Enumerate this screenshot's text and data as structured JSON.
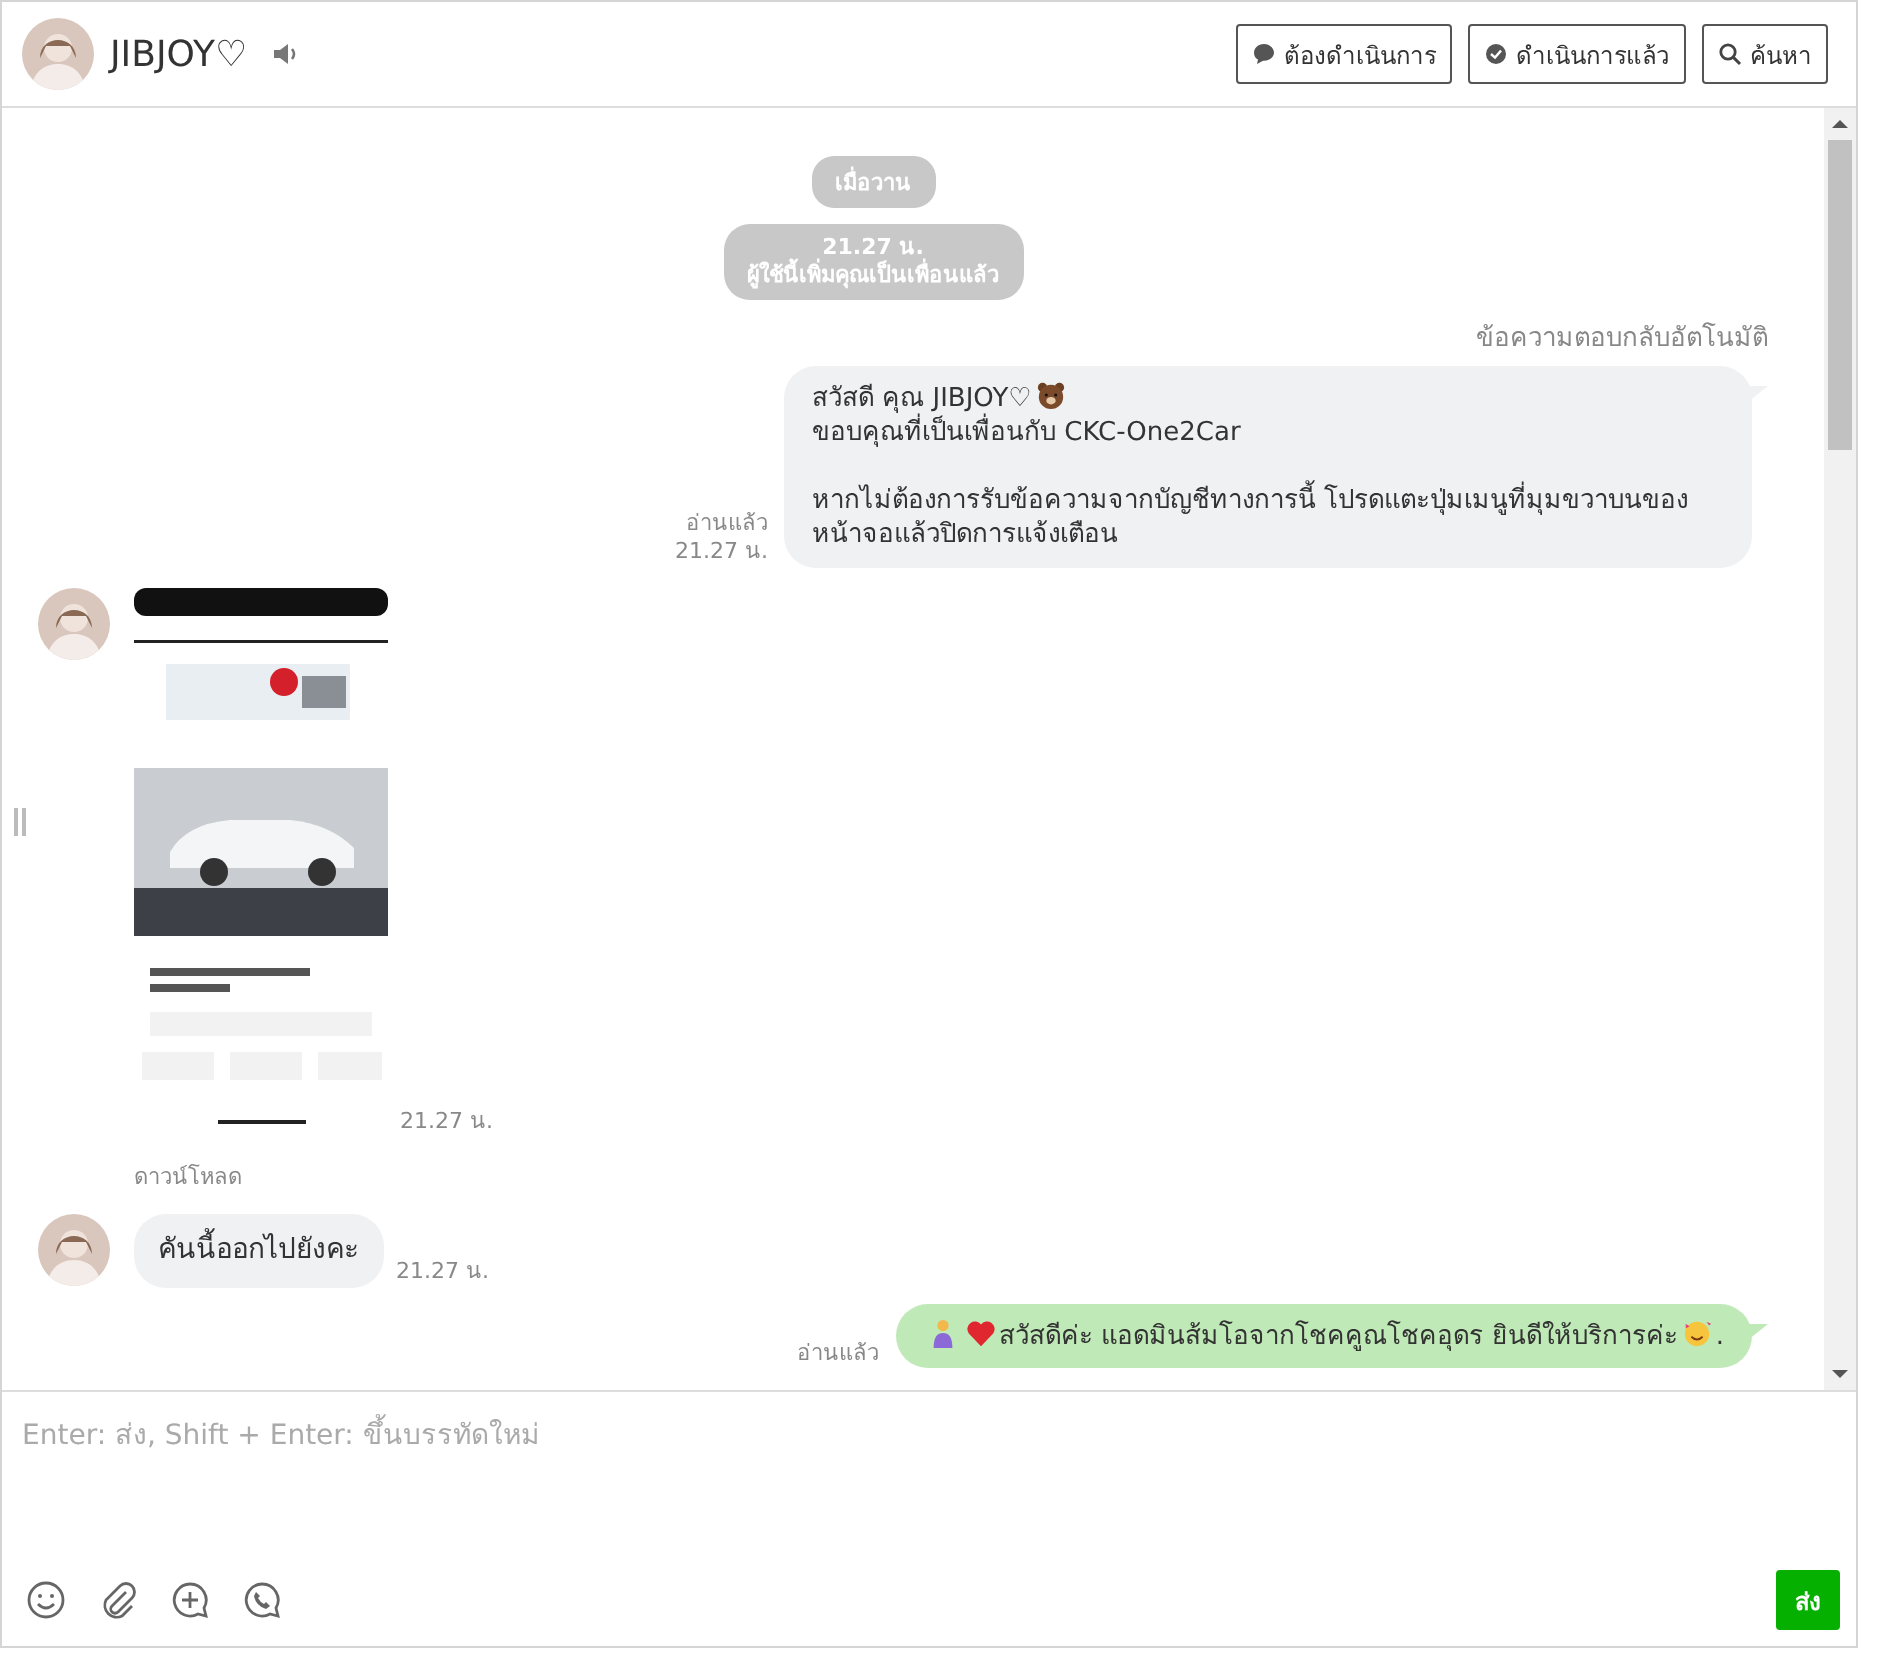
{
  "header": {
    "name": "JIBJOY♡",
    "buttons": [
      {
        "label": "ต้องดำเนินการ",
        "kind": "todo"
      },
      {
        "label": "ดำเนินการแล้ว",
        "kind": "done"
      },
      {
        "label": "ค้นหา",
        "kind": "search"
      }
    ]
  },
  "messages": [
    {
      "kind": "date",
      "text": "เมื่อวาน"
    },
    {
      "kind": "system",
      "lines": [
        "21.27 น.",
        "ผู้ใช้นี้เพิ่มคุณเป็นเพื่อนแล้ว"
      ]
    },
    {
      "kind": "auto_reply",
      "label": "ข้อความตอบกลับอัตโนมัติ",
      "read": "อ่านแล้ว",
      "time": "21.27 น.",
      "paragraphs": [
        [
          [
            {
              "text": "สวัสดี คุณ JIBJOY♡"
            },
            {
              "kind": "emoji"
            }
          ],
          [
            {
              "text": "ขอบคุณที่เป็นเพื่อนกับ CKC-One2Car"
            }
          ]
        ],
        [
          [
            {
              "text": "หากไม่ต้องการรับข้อความจากบัญชีทางการนี้ โปรดแตะปุ่มเมนูที่มุมขวาบนของหน้าจอแล้วปิดการแจ้งเตือน"
            }
          ]
        ]
      ]
    },
    {
      "time": "21.27 น.",
      "download": "ดาวน์โหลด"
    },
    {
      "kind": "incoming",
      "time": "21.27 น.",
      "paragraphs": [
        [
          [
            {
              "text": "คันนี้ออกไปยังคะ"
            }
          ]
        ]
      ]
    },
    {
      "kind": "outgoing",
      "read": "อ่านแล้ว",
      "paragraphs": [
        [
          [
            {
              "kind": "emoji"
            },
            {
              "kind": "emoji"
            },
            {
              "text": "สวัสดีค่ะ แอดมินส้มโอจากโชคคูณโชคอุดร ยินดีให้บริการค่ะ"
            },
            {
              "kind": "emoji"
            },
            {
              "text": "."
            }
          ]
        ]
      ]
    }
  ],
  "composer": {
    "placeholder": "Enter: ส่ง, Shift + Enter: ขึ้นบรรทัดใหม่",
    "send": "ส่ง"
  }
}
